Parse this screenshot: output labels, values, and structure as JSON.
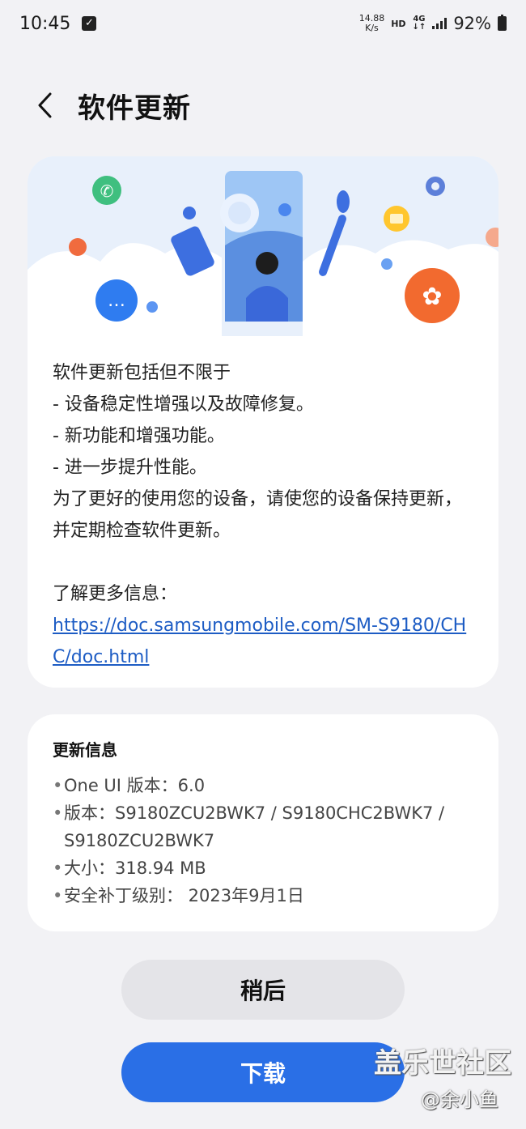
{
  "status_bar": {
    "time": "10:45",
    "net_speed_value": "14.88",
    "net_speed_unit": "K/s",
    "hd": "HD",
    "network": "4G",
    "battery": "92%"
  },
  "header": {
    "title": "软件更新",
    "back_icon": "chevron-left-icon"
  },
  "description_card": {
    "lines": [
      "软件更新包括但不限于",
      "- 设备稳定性增强以及故障修复。",
      "- 新功能和增强功能。",
      "- 进一步提升性能。",
      "为了更好的使用您的设备，请使您的设备保持更新，并定期检查软件更新。"
    ],
    "more_info_label": "了解更多信息：",
    "link": "https://doc.samsungmobile.com/SM-S9180/CHC/doc.html"
  },
  "info_card": {
    "title": "更新信息",
    "items": [
      "One UI 版本：6.0",
      "版本：S9180ZCU2BWK7 / S9180CHC2BWK7 / S9180ZCU2BWK7",
      "大小：318.94 MB",
      "安全补丁级别： 2023年9月1日"
    ]
  },
  "buttons": {
    "later": "稍后",
    "download": "下载"
  },
  "watermark": {
    "main": "盖乐世社区",
    "sub": "@余小鱼"
  },
  "colors": {
    "accent": "#2a6fe6",
    "link": "#1d5cc4",
    "background": "#f2f2f5"
  }
}
